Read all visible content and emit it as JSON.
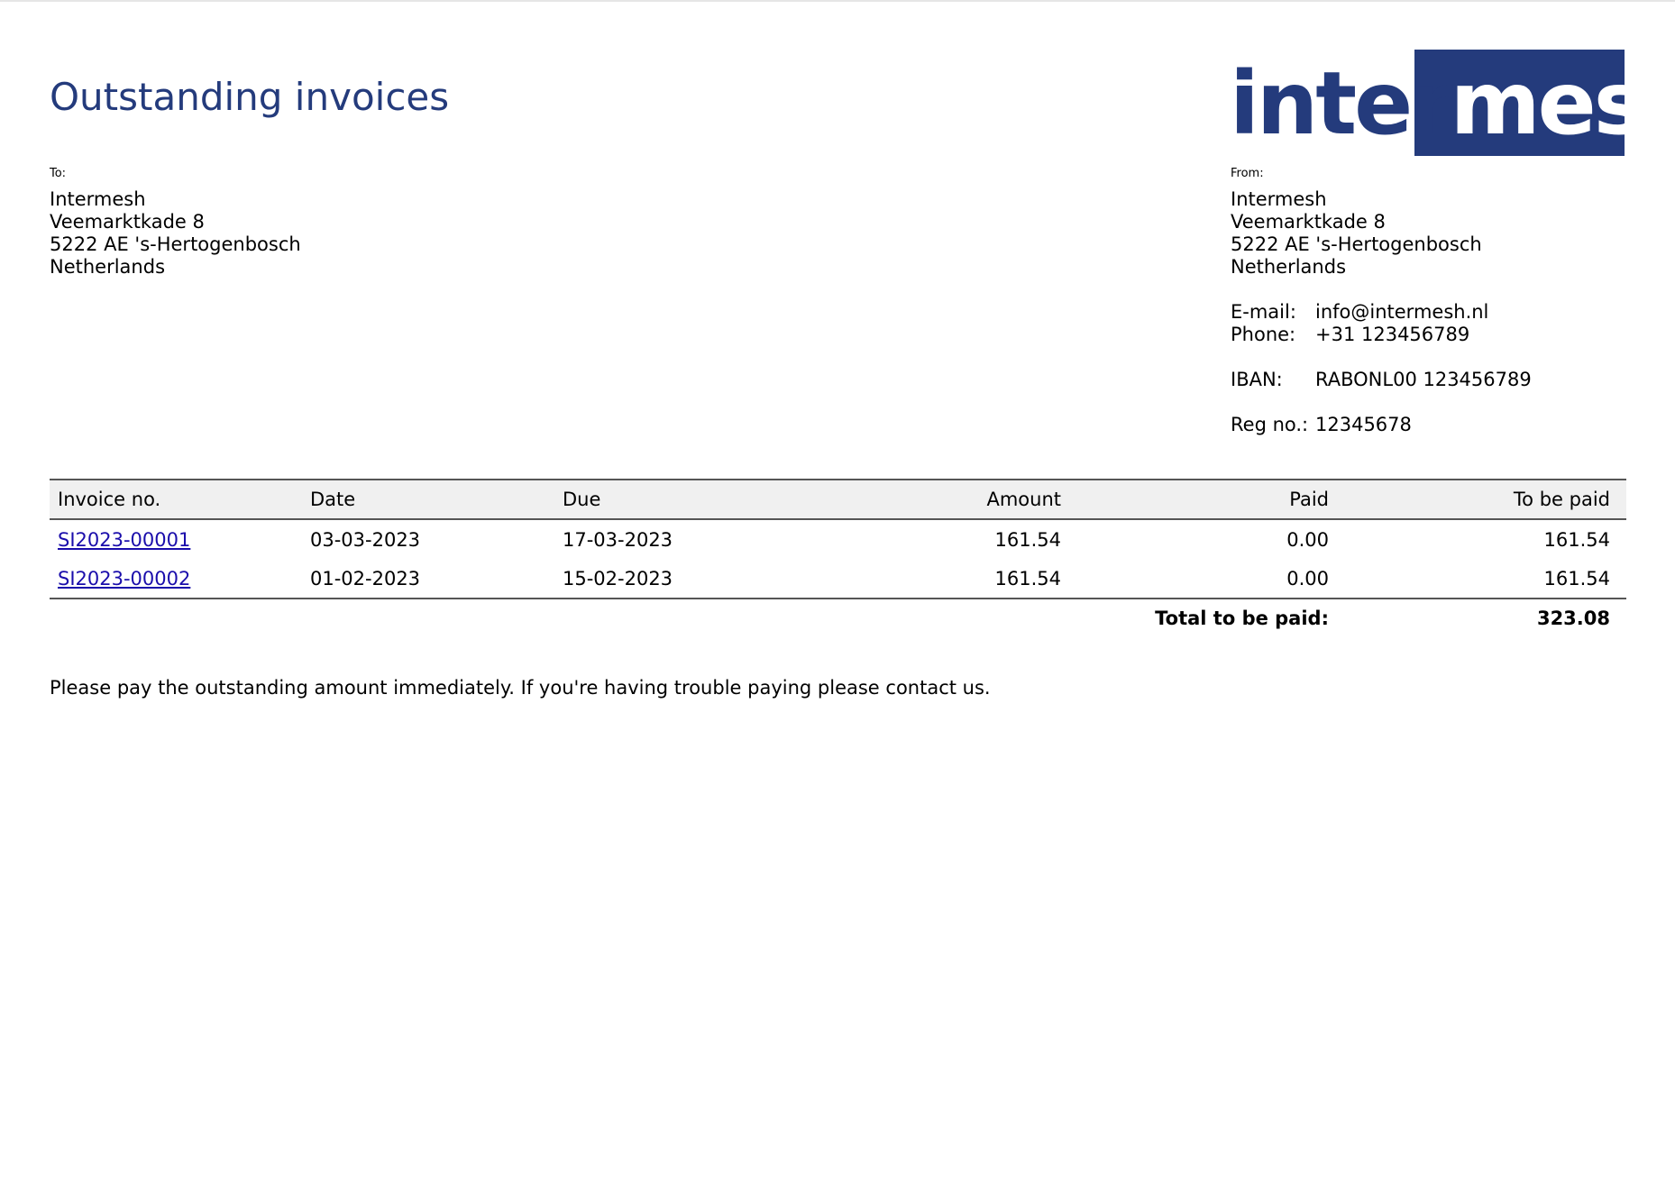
{
  "title": "Outstanding invoices",
  "logo": {
    "text_dark": "inter",
    "text_light": "mesh",
    "colors": {
      "brand": "#243b7c",
      "on_brand": "#ffffff"
    }
  },
  "to": {
    "label": "To:",
    "lines": [
      "Intermesh",
      "Veemarktkade 8",
      "5222 AE 's-Hertogenbosch",
      "Netherlands"
    ]
  },
  "from": {
    "label": "From:",
    "lines": [
      "Intermesh",
      "Veemarktkade 8",
      "5222 AE 's-Hertogenbosch",
      "Netherlands"
    ],
    "email_label": "E-mail:",
    "email": "info@intermesh.nl",
    "phone_label": "Phone:",
    "phone": "+31 123456789",
    "iban_label": "IBAN:",
    "iban": "RABONL00 123456789",
    "reg_label": "Reg no.:",
    "reg": "12345678"
  },
  "table": {
    "headers": {
      "invoice_no": "Invoice no.",
      "date": "Date",
      "due": "Due",
      "amount": "Amount",
      "paid": "Paid",
      "to_be_paid": "To be paid"
    },
    "rows": [
      {
        "invoice_no": "SI2023-00001",
        "date": "03-03-2023",
        "due": "17-03-2023",
        "amount": "161.54",
        "paid": "0.00",
        "to_be_paid": "161.54"
      },
      {
        "invoice_no": "SI2023-00002",
        "date": "01-02-2023",
        "due": "15-02-2023",
        "amount": "161.54",
        "paid": "0.00",
        "to_be_paid": "161.54"
      }
    ],
    "total_label": "Total to be paid:",
    "total_value": "323.08"
  },
  "note": "Please pay the outstanding amount immediately. If you're having trouble paying please contact us.",
  "colors": {
    "title": "#243b7c",
    "link": "#1a0dab",
    "header_bg": "#f0f0f0"
  }
}
